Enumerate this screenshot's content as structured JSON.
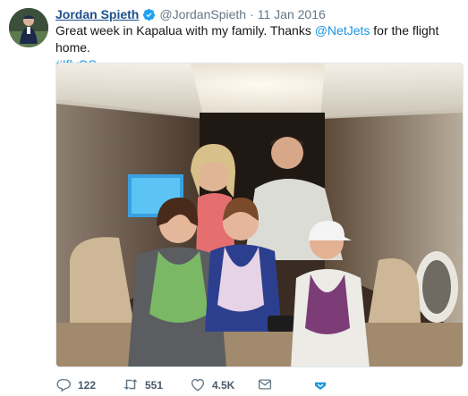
{
  "tweet": {
    "author_name": "Jordan Spieth",
    "handle": "@JordanSpieth",
    "separator": "·",
    "date": "11 Jan 2016",
    "text_part1": "Great week in Kapalua with my family. Thanks ",
    "mention": "@NetJets",
    "text_part2": " for the flight home.",
    "hashtag": "#IflyQS"
  },
  "actions": {
    "replies": "122",
    "retweets": "551",
    "likes": "4.5K"
  },
  "icons": {
    "verified": "verified-badge-icon",
    "reply": "reply-icon",
    "retweet": "retweet-icon",
    "like": "heart-icon",
    "dm": "envelope-icon",
    "more": "chevron-down-icon"
  },
  "colors": {
    "link": "#1b95e0",
    "name": "#1d4f8c",
    "meta": "#657786",
    "verified": "#1da1f2"
  }
}
